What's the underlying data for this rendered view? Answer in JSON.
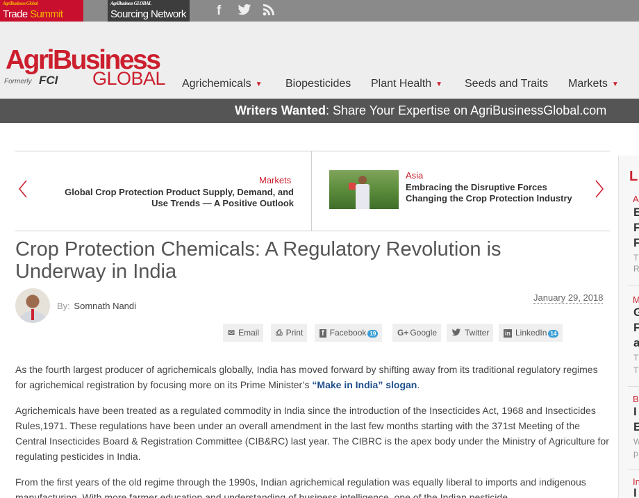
{
  "topbar": {
    "trade_summit": {
      "small": "AgriBusiness Global",
      "word1": "Trade ",
      "word2": "Summit"
    },
    "sourcing_network": {
      "small": "AgriBusiness GLOBAL",
      "text": "Sourcing Network"
    },
    "social": [
      "facebook-icon",
      "twitter-icon",
      "rss-icon"
    ]
  },
  "header": {
    "brand_agri": "AgriBusiness",
    "brand_global": "GLOBAL",
    "formerly": "Formerly",
    "fci": "FCI",
    "nav": [
      {
        "label": "Agrichemicals",
        "dropdown": true
      },
      {
        "label": "Biopesticides",
        "dropdown": false
      },
      {
        "label": "Plant Health",
        "dropdown": true
      },
      {
        "label": "Seeds and Traits",
        "dropdown": false
      },
      {
        "label": "Markets",
        "dropdown": true
      }
    ]
  },
  "banner": {
    "bold": "Writers Wanted",
    "rest": ": Share Your Expertise on AgriBusinessGlobal.com"
  },
  "prev_next": {
    "prev": {
      "category": "Markets",
      "title_line1": "Global Crop Protection Product Supply, Demand, and",
      "title_line2": "Use Trends — A Positive Outlook"
    },
    "next": {
      "category": "Asia",
      "title_line1": "Embracing the Disruptive Forces",
      "title_line2": "Changing the Crop Protection Industry"
    }
  },
  "article": {
    "title_line1": "Crop Protection Chemicals: A Regulatory Revolution is",
    "title_line2": "Underway in India",
    "by_label": "By:",
    "author": "Somnath Nandi",
    "date": "January 29, 2018",
    "share": [
      {
        "label": "Email",
        "icon": "envelope-icon",
        "glyph": "✉"
      },
      {
        "label": "Print",
        "icon": "printer-icon",
        "glyph": "⎙"
      },
      {
        "label": "Facebook",
        "icon": "facebook-icon",
        "glyph": "f",
        "count": "19"
      },
      {
        "label": "Google",
        "icon": "google-plus-icon",
        "glyph": "G+"
      },
      {
        "label": "Twitter",
        "icon": "twitter-icon",
        "glyph": "🐦"
      },
      {
        "label": "LinkedIn",
        "icon": "linkedin-icon",
        "glyph": "in",
        "count": "14"
      }
    ],
    "p1_text": "As the fourth largest producer of agrichemicals globally, India has moved forward by shifting away from its traditional regulatory regimes for agrichemical registration by focusing more on its Prime Minister’s ",
    "p1_link": "“Make in India” slogan",
    "p1_end": ".",
    "p2": "Agrichemicals have been treated as a regulated commodity in India since the introduction of the Insecticides Act, 1968 and Insecticides Rules,1971. These regulations have been under an overall amendment in the last few months starting with the 371st Meeting of the Central Insecticides Board & Registration Committee (CIB&RC) last year. The CIBRC is the apex body under the Ministry of Agriculture for regulating pesticides in India.",
    "p3": "From the first years of the old regime through the 1990s, Indian agrichemical regulation was equally liberal to imports and indigenous manufacturing. With more farmer education and understanding of business intelligence, one of the Indian pesticide"
  },
  "sidebar": {
    "heading_char": "L",
    "items": [
      {
        "cat": "A",
        "title": [
          "E",
          "F",
          "F"
        ],
        "excerpt": [
          "T",
          "R"
        ]
      },
      {
        "cat": "M",
        "title": [
          "G",
          "F",
          "a"
        ],
        "excerpt": [
          "T",
          "T"
        ]
      },
      {
        "cat": "B",
        "title": [
          "I",
          "E"
        ],
        "excerpt": [
          "W",
          "p"
        ]
      },
      {
        "cat": "In",
        "title": [
          "I"
        ],
        "excerpt": []
      }
    ]
  }
}
